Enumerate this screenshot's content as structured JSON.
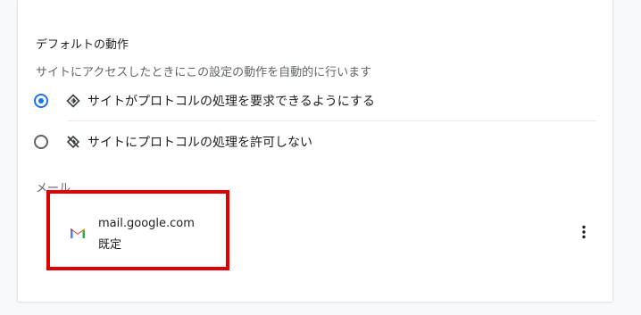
{
  "default_behavior": {
    "title": "デフォルトの動作",
    "description": "サイトにアクセスしたときにこの設定の動作を自動的に行います",
    "options": [
      {
        "label": "サイトがプロトコルの処理を要求できるようにする",
        "icon": "protocol-handler-icon",
        "selected": true
      },
      {
        "label": "サイトにプロトコルの処理を許可しない",
        "icon": "protocol-handler-off-icon",
        "selected": false
      }
    ]
  },
  "mail_section": {
    "heading": "メール",
    "site": {
      "name": "mail.google.com",
      "status": "既定",
      "icon": "gmail-icon"
    },
    "more_icon": "more-vert-icon"
  },
  "colors": {
    "accent": "#1a73e8",
    "highlight_box": "#e00000"
  }
}
